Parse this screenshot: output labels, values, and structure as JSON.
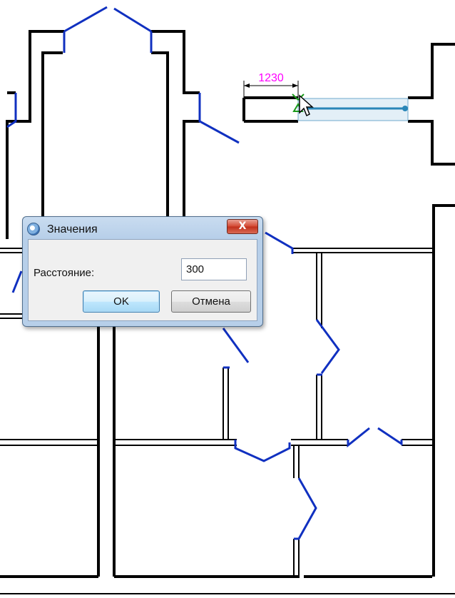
{
  "drawing": {
    "dimension_label": "1230",
    "dimension_color": "#ff00ff",
    "wall_color": "#000000",
    "door_color": "#1030c0",
    "selection_color": "#2a86b8"
  },
  "dialog": {
    "title": "Значения",
    "close_label": "X",
    "field_label": "Расстояние:",
    "field_value": "300",
    "ok_label": "OK",
    "cancel_label": "Отмена"
  }
}
